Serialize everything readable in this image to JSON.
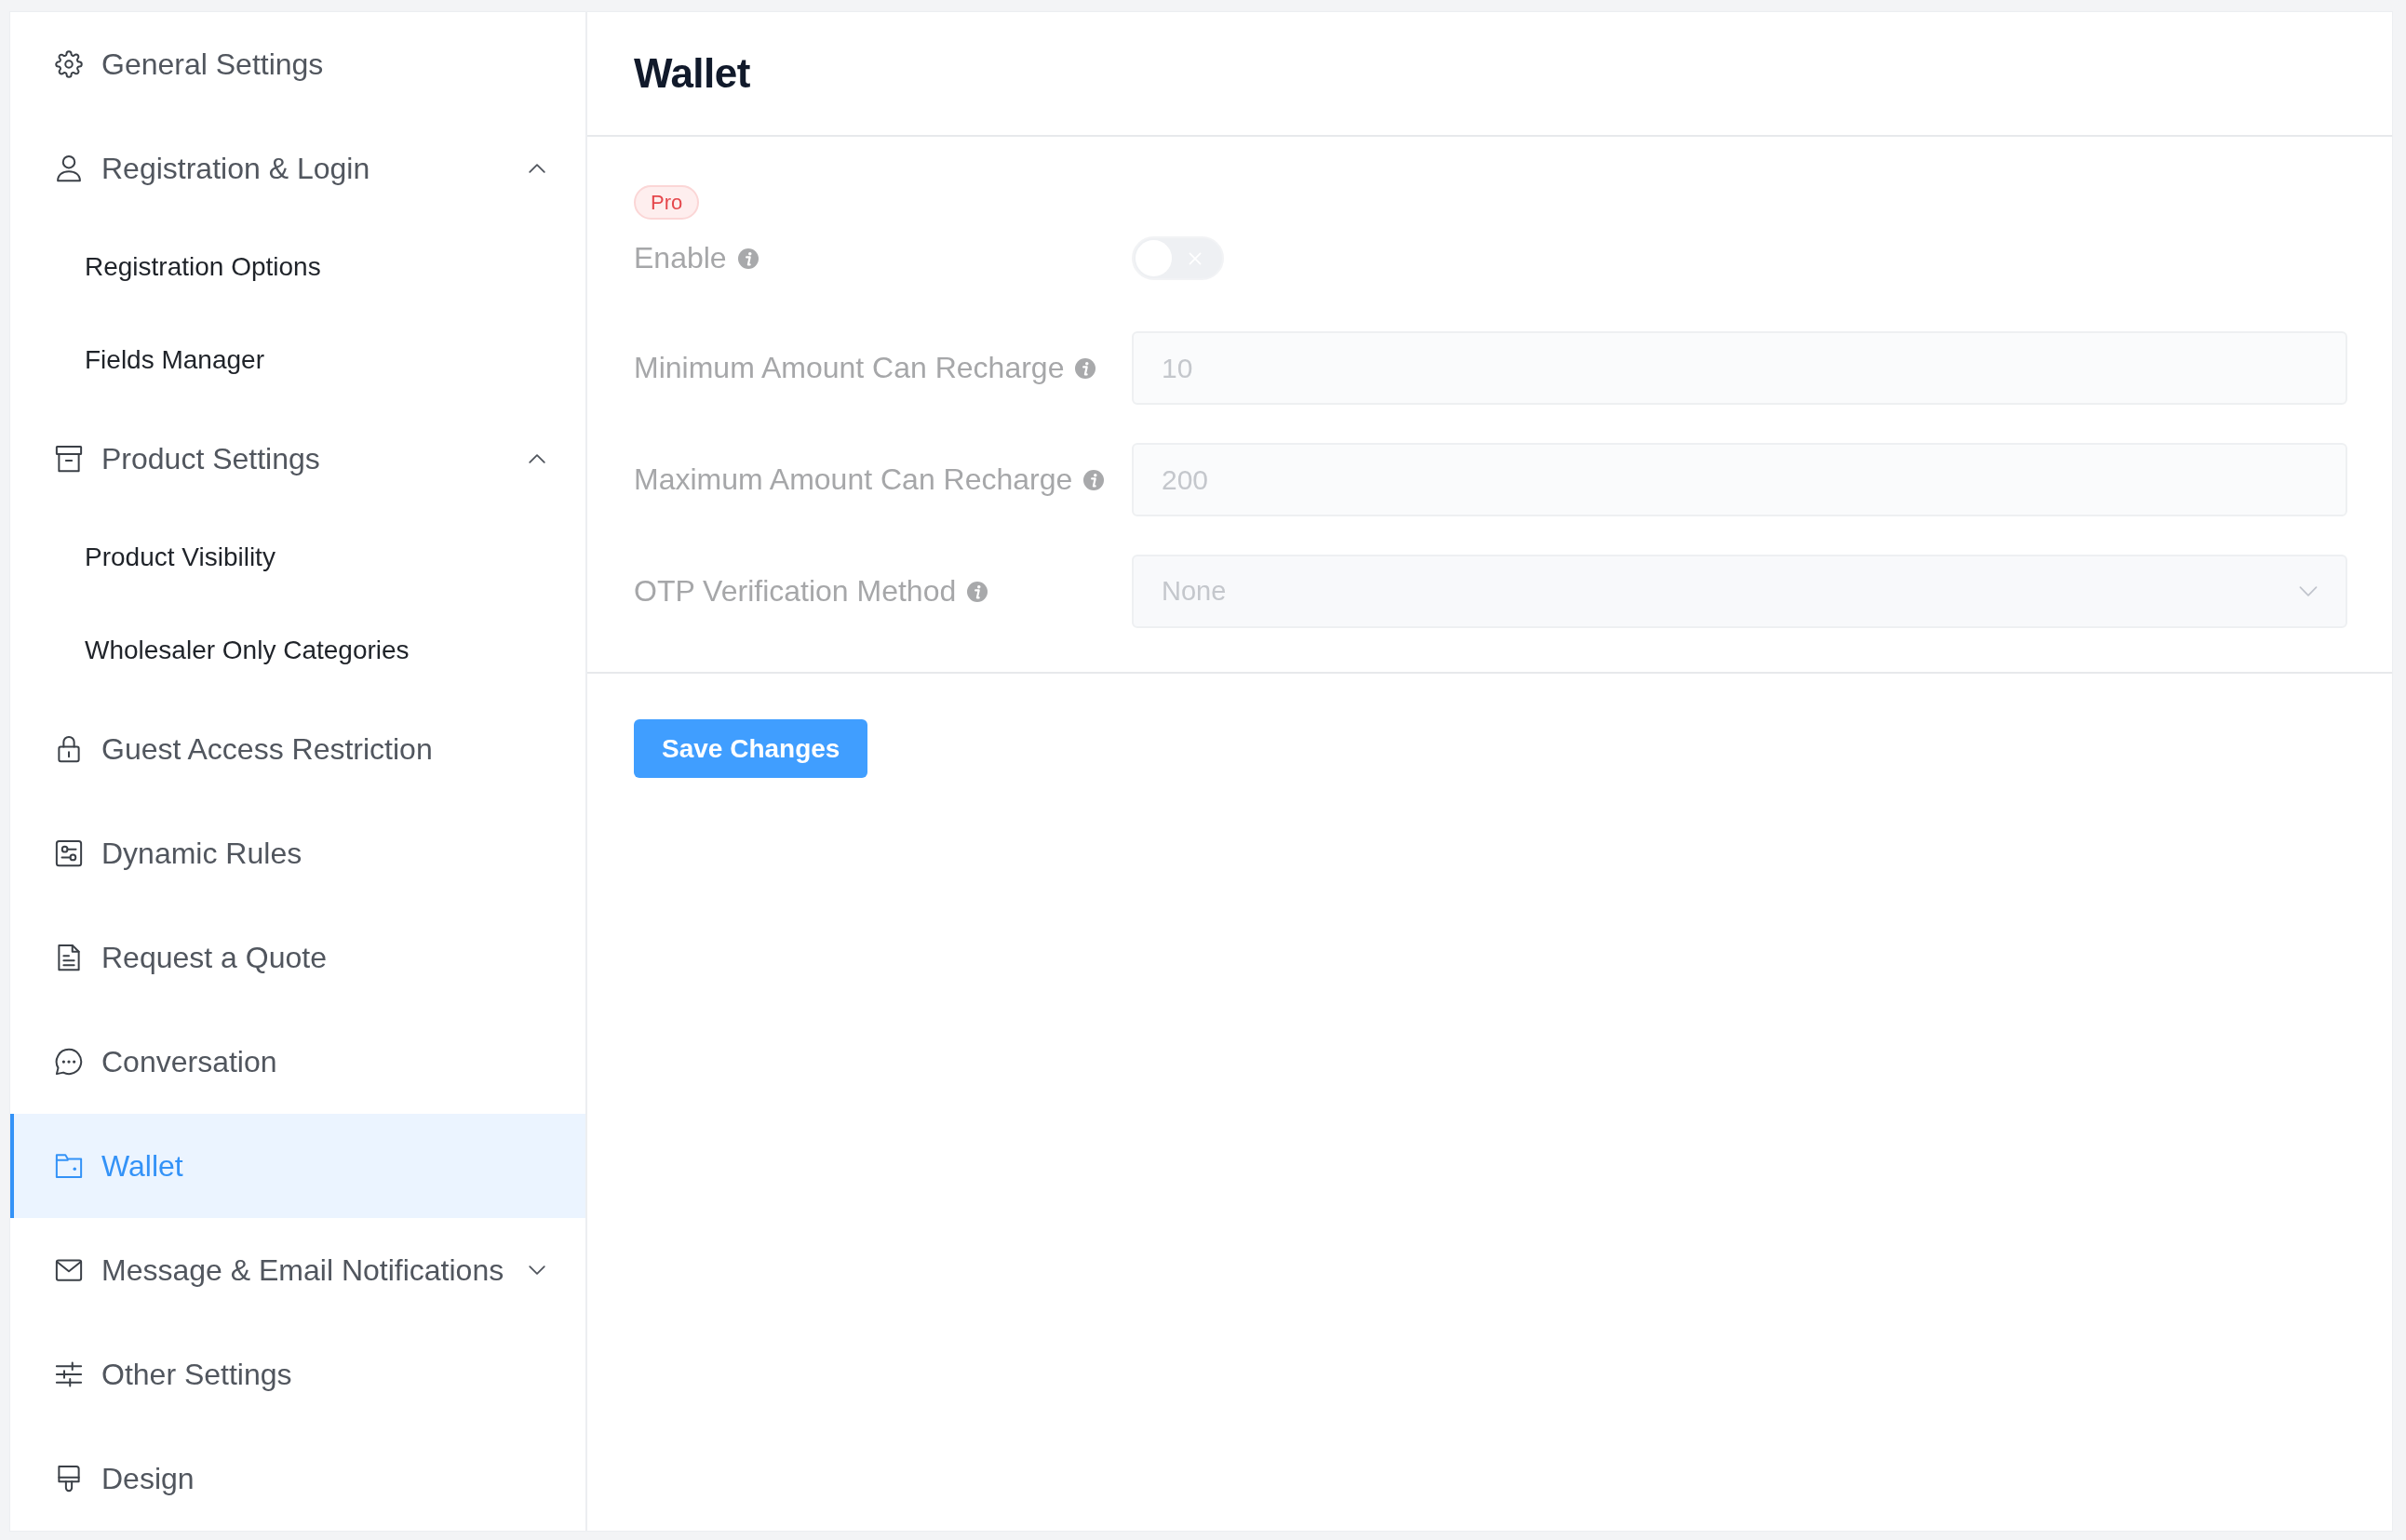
{
  "sidebar": {
    "items": [
      {
        "kind": "link",
        "label": "General Settings",
        "selected": false
      },
      {
        "kind": "group",
        "label": "Registration & Login",
        "selected": false,
        "expanded": true,
        "children": [
          {
            "label": "Registration Options",
            "selected": false
          },
          {
            "label": "Fields Manager",
            "selected": false
          }
        ]
      },
      {
        "kind": "group",
        "label": "Product Settings",
        "selected": false,
        "expanded": true,
        "children": [
          {
            "label": "Product Visibility",
            "selected": false
          },
          {
            "label": "Wholesaler Only Categories",
            "selected": false
          }
        ]
      },
      {
        "kind": "link",
        "label": "Guest Access Restriction",
        "selected": false
      },
      {
        "kind": "link",
        "label": "Dynamic Rules",
        "selected": false
      },
      {
        "kind": "link",
        "label": "Request a Quote",
        "selected": false
      },
      {
        "kind": "link",
        "label": "Conversation",
        "selected": false
      },
      {
        "kind": "link",
        "label": "Wallet",
        "selected": true
      },
      {
        "kind": "group",
        "label": "Message & Email Notifications",
        "selected": false,
        "expanded": false
      },
      {
        "kind": "link",
        "label": "Other Settings",
        "selected": false
      },
      {
        "kind": "link",
        "label": "Design",
        "selected": false
      }
    ]
  },
  "page": {
    "title": "Wallet"
  },
  "form": {
    "badge": "Pro",
    "fields": [
      {
        "kind": "toggle",
        "label": "Enable",
        "on": false,
        "disabled": true
      },
      {
        "kind": "number",
        "label": "Minimum Amount Can Recharge",
        "value": "10",
        "disabled": true
      },
      {
        "kind": "number",
        "label": "Maximum Amount Can Recharge",
        "value": "200",
        "disabled": true
      },
      {
        "kind": "select",
        "label": "OTP Verification Method",
        "value": "None",
        "disabled": true
      }
    ]
  },
  "actions": {
    "save_button": "Save Changes"
  }
}
